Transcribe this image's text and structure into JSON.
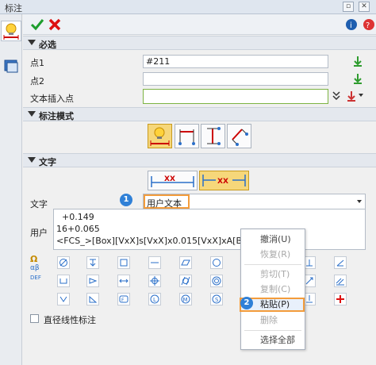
{
  "window": {
    "title": "标注"
  },
  "sections": {
    "required": "必选",
    "mode": "标注模式",
    "text": "文字"
  },
  "rows": {
    "point1_label": "点1",
    "point1_value": "#211",
    "point2_label": "点2",
    "point2_value": "",
    "insert_label": "文本插入点",
    "insert_value": ""
  },
  "text_section": {
    "text_label": "文字",
    "text_select": "用户文本",
    "user_label": "用户",
    "user_lines": [
      "+0.149",
      "16+0.065",
      "<FCS_>[Box][VxX]s[VxX]x0.015[VxX]xA[Box]"
    ]
  },
  "textbtn_label": "XX",
  "badges": [
    "1",
    "2"
  ],
  "context_menu": {
    "items": [
      {
        "label": "撤消(U)",
        "enabled": true
      },
      {
        "label": "恢复(R)",
        "enabled": false
      },
      {
        "label": "剪切(T)",
        "enabled": false
      },
      {
        "label": "复制(C)",
        "enabled": false
      },
      {
        "label": "粘贴(P)",
        "enabled": true,
        "highlighted": true
      },
      {
        "label": "删除",
        "enabled": false
      },
      {
        "label": "选择全部",
        "enabled": true
      }
    ]
  },
  "checkbox": {
    "label": "直径线性标注",
    "checked": false
  },
  "colors": {
    "accent": "#f39c3b",
    "badge": "#2f80d7",
    "highlight": "#f6d77a"
  }
}
